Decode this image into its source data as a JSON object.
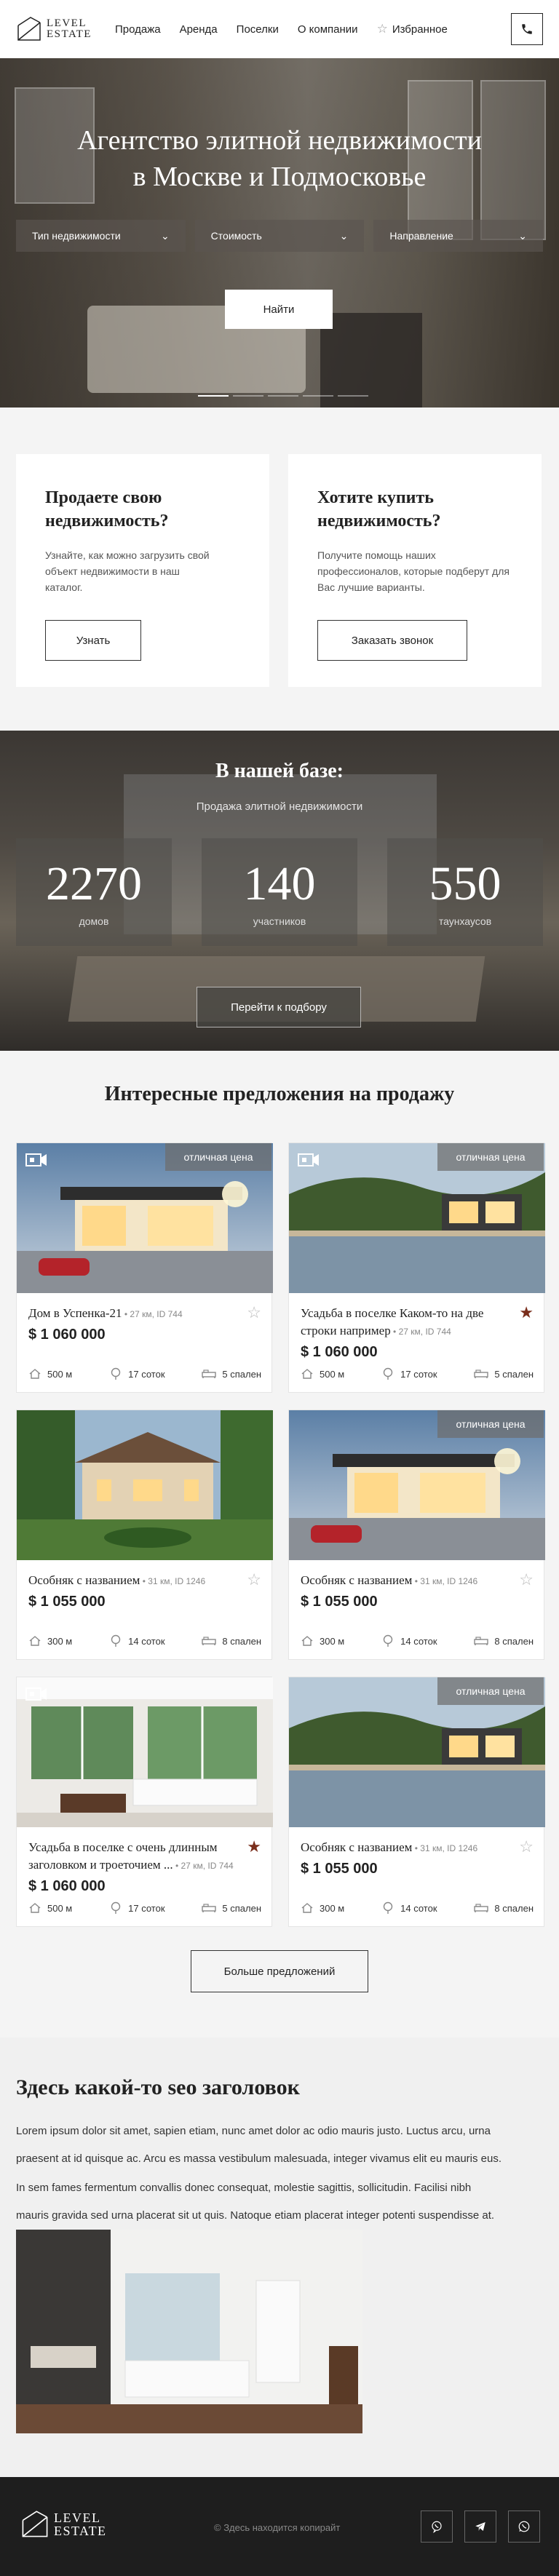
{
  "header": {
    "logo_line1": "LEVEL",
    "logo_line2": "ESTATE",
    "nav": [
      "Продажа",
      "Аренда",
      "Поселки",
      "О компании"
    ],
    "favorites_label": "Избранное"
  },
  "hero": {
    "title_line1": "Агентство элитной недвижимости",
    "title_line2": "в Москве и Подмосковье",
    "filters": [
      {
        "label": "Тип недвижимости"
      },
      {
        "label": "Стоимость"
      },
      {
        "label": "Направление"
      }
    ],
    "find_button": "Найти",
    "slides_total": 5,
    "slide_active": 1
  },
  "cta": {
    "sell": {
      "title_line1": "Продаете свою",
      "title_line2": "недвижимость?",
      "text": "Узнайте, как можно загрузить свой объект недвижимости в наш каталог.",
      "button": "Узнать"
    },
    "buy": {
      "title_line1": "Хотите купить",
      "title_line2": "недвижимость?",
      "text": "Получите помощь наших профессионалов, которые подберут для Вас лучшие варианты.",
      "button": "Заказать звонок"
    }
  },
  "database": {
    "title": "В нашей базе:",
    "subtitle": "Продажа элитной недвижимости",
    "stats": [
      {
        "num": "2270",
        "label": "домов"
      },
      {
        "num": "140",
        "label": "участников"
      },
      {
        "num": "550",
        "label": "таунхаусов"
      }
    ],
    "button": "Перейти к подбору"
  },
  "offers": {
    "title": "Интересные предложения на продажу",
    "cards": [
      {
        "badge": "отличная цена",
        "video": true,
        "favorite": false,
        "title": "Дом в Успенка-21",
        "meta": " • 27 км, ID 744",
        "price": "$ 1 060 000",
        "distance": "500 м",
        "area": "17 соток",
        "rooms": "5 спален",
        "photo": "modern"
      },
      {
        "badge": "отличная цена",
        "video": true,
        "favorite": true,
        "title": "Усадьба в поселке Каком-то на две строки например",
        "meta": " • 27 км, ID 744",
        "price": "$ 1 060 000",
        "distance": "500 м",
        "area": "17 соток",
        "rooms": "5 спален",
        "photo": "lake"
      },
      {
        "badge": "",
        "video": false,
        "favorite": false,
        "title": "Особняк с названием",
        "meta": " • 31 км, ID 1246",
        "price": "$ 1 055 000",
        "distance": "300 м",
        "area": "14 соток",
        "rooms": "8 спален",
        "photo": "mansion"
      },
      {
        "badge": "отличная цена",
        "video": false,
        "favorite": false,
        "title": "Особняк с названием",
        "meta": " • 31 км, ID 1246",
        "price": "$ 1 055 000",
        "distance": "300 м",
        "area": "14 соток",
        "rooms": "8 спален",
        "photo": "modern"
      },
      {
        "badge": "",
        "video": true,
        "favorite": true,
        "title": "Усадьба в поселке с очень длинным заголовком и троеточием ...",
        "meta": " • 27 км, ID 744",
        "price": "$ 1 060 000",
        "distance": "500 м",
        "area": "17 соток",
        "rooms": "5 спален",
        "photo": "interior"
      },
      {
        "badge": "отличная цена",
        "video": false,
        "favorite": false,
        "title": "Особняк с названием",
        "meta": " • 31 км, ID 1246",
        "price": "$ 1 055 000",
        "distance": "300 м",
        "area": "14 соток",
        "rooms": "8 спален",
        "photo": "lake"
      }
    ],
    "more_button": "Больше предложений"
  },
  "seo": {
    "title": "Здесь какой-то seo заголовок",
    "p1_line1": "Lorem ipsum dolor sit amet, sapien etiam, nunc amet dolor ac odio mauris justo. Luctus arcu, urna",
    "p1_line2": "praesent at id quisque ac. Arcu es massa vestibulum malesuada, integer vivamus elit eu mauris eus.",
    "p2_line1": "In sem fames fermentum convallis donec consequat, molestie sagittis, sollicitudin. Facilisi nibh",
    "p2_line2": "mauris gravida sed urna placerat sit ut quis. Natoque etiam placerat integer potenti suspendisse at."
  },
  "footer": {
    "logo_line1": "LEVEL",
    "logo_line2": "ESTATE",
    "copyright": "© Здесь находится копирайт",
    "social": [
      "viber-icon",
      "telegram-icon",
      "whatsapp-icon"
    ]
  },
  "colors": {
    "accent_star": "#7a2e1c",
    "footer_bg": "#1e1e1e",
    "page_bg": "#f4f4f4"
  }
}
